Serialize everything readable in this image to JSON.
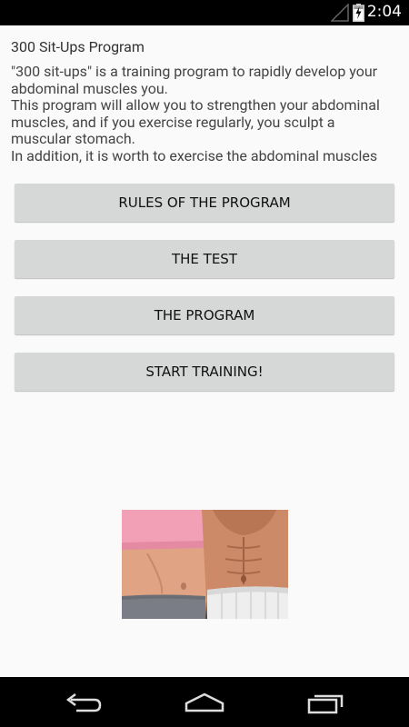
{
  "status_bar": {
    "time": "2:04",
    "icons": [
      "signal-icon",
      "battery-charging-icon"
    ]
  },
  "app": {
    "title": "300 Sit-Ups Program",
    "intro_lines": [
      "\"300 sit-ups\" is a training program to rapidly develop your abdominal muscles you.",
      "This program will allow you to strengthen your abdominal muscles, and if you exercise regularly, you sculpt a muscular stomach.",
      "In addition, it is worth to exercise the abdominal muscles"
    ]
  },
  "menu": {
    "rules_label": "RULES OF THE PROGRAM",
    "test_label": "THE TEST",
    "program_label": "THE PROGRAM",
    "start_label": "START TRAINING!"
  },
  "navigation": {
    "icons": [
      "back-icon",
      "home-icon",
      "recent-apps-icon"
    ]
  }
}
